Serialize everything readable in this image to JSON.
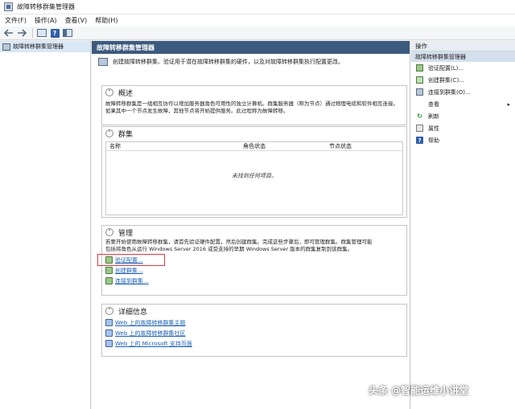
{
  "window": {
    "title": "故障转移群集管理器",
    "icon": "cluster-manager-icon"
  },
  "menu": {
    "items": [
      "文件(F)",
      "操作(A)",
      "查看(V)",
      "帮助(H)"
    ]
  },
  "toolbar": {
    "icons": [
      "back-arrow-icon",
      "forward-arrow-icon",
      "show-hide-console-tree-icon",
      "help-icon",
      "show-hide-action-pane-icon"
    ],
    "help_glyph": "?"
  },
  "tree": {
    "items": [
      {
        "label": "故障转移群集管理器",
        "icon": "cluster-manager-icon",
        "selected": true
      }
    ]
  },
  "center": {
    "header": "故障转移群集管理器",
    "intro": "创建故障转移群集、验证用于潜在故障转移群集的硬件，以及对故障转移群集执行配置更改。",
    "overview": {
      "title": "概述",
      "body": "故障转移群集是一组相互协作以增加服务器角色可用性的独立计算机。群集服务器（称为节点）通过物理电缆和软件相互连接。如果其中一个节点发生故障，其他节点将开始提供服务。此过程称为故障转移。"
    },
    "clusters": {
      "title": "群集",
      "columns": [
        "名称",
        "角色状态",
        "节点状态"
      ],
      "empty": "未找到任何项目。"
    },
    "management": {
      "title": "管理",
      "body_line1": "若要开始使用故障转移群集，请首先验证硬件配置，然后创建群集。完成这些步骤后，即可管理群集。群集管理可能",
      "body_line2": "包括将角色从运行 Windows Server 2016 或受支持的早期 Windows Server 版本的群集复制到该群集。",
      "links": [
        "验证配置...",
        "创建群集...",
        "连接到群集..."
      ]
    },
    "details": {
      "title": "详细信息",
      "links": [
        "Web 上的故障转移群集主题",
        "Web 上的故障转移群集社区",
        "Web 上的 Microsoft 支持页面"
      ]
    }
  },
  "actions": {
    "header": "操作",
    "sub": "故障转移群集管理器",
    "items": [
      "验证配置(L)...",
      "创建群集(C)...",
      "连接到群集(O)...",
      "查看",
      "刷新",
      "属性",
      "帮助"
    ],
    "icons": [
      "validate-config-icon",
      "create-cluster-icon",
      "connect-cluster-icon",
      "",
      "refresh-icon",
      "properties-icon",
      "help-icon"
    ],
    "view_arrow": "▸",
    "refresh_glyph": "↻",
    "help_glyph": "?"
  },
  "watermark": "头条 @智能运维小讲堂",
  "colors": {
    "header_bg": "#3c5a7d",
    "link": "#1a5fb4",
    "highlight": "#e03b3b",
    "action_sub_bg": "#d4dfec"
  }
}
